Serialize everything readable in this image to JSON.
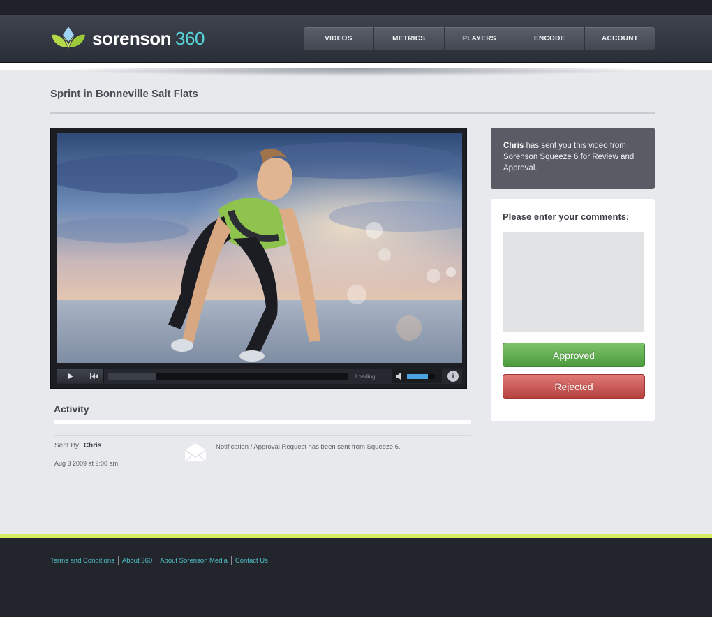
{
  "brand": {
    "name": "sorenson",
    "suffix": "360"
  },
  "nav": {
    "items": [
      {
        "label": "VIDEOS"
      },
      {
        "label": "METRICS"
      },
      {
        "label": "PLAYERS"
      },
      {
        "label": "ENCODE"
      },
      {
        "label": "ACCOUNT"
      }
    ]
  },
  "page": {
    "title": "Sprint in Bonneville Salt Flats"
  },
  "player": {
    "status_text": "Loading",
    "progress": 0.2,
    "volume": 0.75,
    "info_label": "i"
  },
  "notice": {
    "sender": "Chris",
    "message": "has sent you this video from Sorenson Squeeze 6 for Review and Approval."
  },
  "comments": {
    "label": "Please enter your comments:",
    "value": "",
    "approve_label": "Approved",
    "reject_label": "Rejected"
  },
  "activity": {
    "title": "Activity",
    "sent_by_label": "Sent By:",
    "sent_by_name": "Chris",
    "date": "Aug 3 2009 at 9:00 am",
    "message": "Notification / Approval Request has been sent from Squeeze 6."
  },
  "footer": {
    "links": [
      {
        "label": "Terms and Conditions"
      },
      {
        "label": "About 360"
      },
      {
        "label": "About Sorenson Media"
      },
      {
        "label": "Contact Us"
      }
    ]
  },
  "colors": {
    "accent": "#56d4d8",
    "approve": "#5aa94a",
    "reject": "#c4504d",
    "footer_accent": "#d7ec63"
  }
}
